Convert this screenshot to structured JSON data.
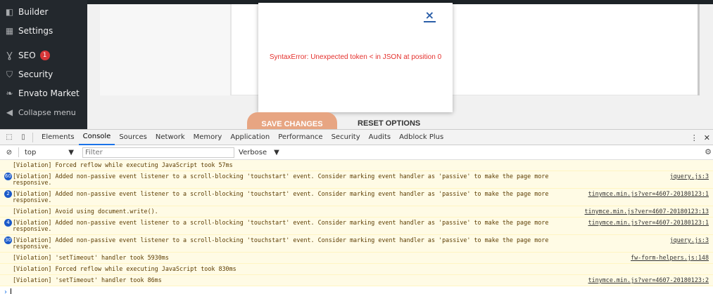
{
  "sidebar": {
    "items": [
      {
        "label": "Builder",
        "icon": "builder-icon"
      },
      {
        "label": "Settings",
        "icon": "settings-icon"
      },
      {
        "label": "SEO",
        "icon": "yoast-seo-icon",
        "badge": "1"
      },
      {
        "label": "Security",
        "icon": "shield-icon"
      },
      {
        "label": "Envato Market",
        "icon": "leaf-icon"
      },
      {
        "label": "Collapse menu",
        "icon": "collapse-icon"
      }
    ]
  },
  "modal": {
    "close": "×",
    "error": "SyntaxError: Unexpected token < in JSON at position 0"
  },
  "actions": {
    "save": "SAVE CHANGES",
    "reset": "RESET OPTIONS"
  },
  "devtools": {
    "tabs": [
      "Elements",
      "Console",
      "Sources",
      "Network",
      "Memory",
      "Application",
      "Performance",
      "Security",
      "Audits",
      "Adblock Plus"
    ],
    "active_tab": "Console",
    "context": "top",
    "filter_placeholder": "Filter",
    "level": "Verbose",
    "logs": [
      {
        "count": "",
        "message": "[Violation] Forced reflow while executing JavaScript took 57ms",
        "source": ""
      },
      {
        "count": "60",
        "message": "[Violation] Added non-passive event listener to a scroll-blocking 'touchstart' event. Consider marking event handler as 'passive' to make the page more responsive.",
        "source": "jquery.js:3"
      },
      {
        "count": "2",
        "message": "[Violation] Added non-passive event listener to a scroll-blocking 'touchstart' event. Consider marking event handler as 'passive' to make the page more responsive.",
        "source": "tinymce.min.js?ver=4607-20180123:1"
      },
      {
        "count": "",
        "message": "[Violation] Avoid using document.write().",
        "source": "tinymce.min.js?ver=4607-20180123:13"
      },
      {
        "count": "4",
        "message": "[Violation] Added non-passive event listener to a scroll-blocking 'touchstart' event. Consider marking event handler as 'passive' to make the page more responsive.",
        "source": "tinymce.min.js?ver=4607-20180123:1"
      },
      {
        "count": "30",
        "message": "[Violation] Added non-passive event listener to a scroll-blocking 'touchstart' event. Consider marking event handler as 'passive' to make the page more responsive.",
        "source": "jquery.js:3"
      },
      {
        "count": "",
        "message": "[Violation] 'setTimeout' handler took 5930ms",
        "source": "fw-form-helpers.js:148"
      },
      {
        "count": "",
        "message": "[Violation] Forced reflow while executing JavaScript took 830ms",
        "source": ""
      },
      {
        "count": "",
        "message": "[Violation] 'setTimeout' handler took 86ms",
        "source": "tinymce.min.js?ver=4607-20180123:2"
      }
    ]
  },
  "colors": {
    "sidebar_bg": "#23282d",
    "error_red": "#e4312d",
    "save_button": "#e7a582",
    "violation_bg": "#fffbe5",
    "count_badge": "#1a59c9"
  }
}
